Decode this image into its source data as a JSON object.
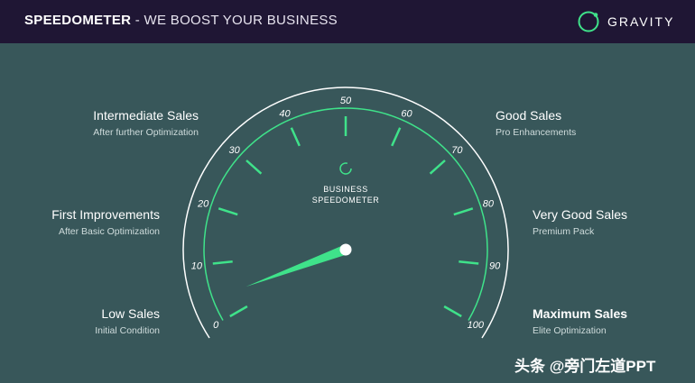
{
  "header": {
    "title_bold": "SPEEDOMETER",
    "title_rest": "- WE BOOST YOUR BUSINESS",
    "brand": "GRAVITY"
  },
  "gauge": {
    "center_label_line1": "BUSINESS",
    "center_label_line2": "SPEEDOMETER",
    "ticks": [
      "0",
      "10",
      "20",
      "30",
      "40",
      "50",
      "60",
      "70",
      "80",
      "90",
      "100"
    ],
    "needle_value": 4,
    "accent_color": "#3fe28a",
    "ring_color": "#ffffff"
  },
  "stages": [
    {
      "title": "Low Sales",
      "subtitle": "Initial Condition"
    },
    {
      "title": "First Improvements",
      "subtitle": "After Basic Optimization"
    },
    {
      "title": "Intermediate Sales",
      "subtitle": "After further Optimization"
    },
    {
      "title": "Good Sales",
      "subtitle": "Pro Enhancements"
    },
    {
      "title": "Very Good Sales",
      "subtitle": "Premium Pack"
    },
    {
      "title": "Maximum Sales",
      "subtitle": "Elite Optimization"
    }
  ],
  "watermark": "头条 @旁门左道PPT"
}
